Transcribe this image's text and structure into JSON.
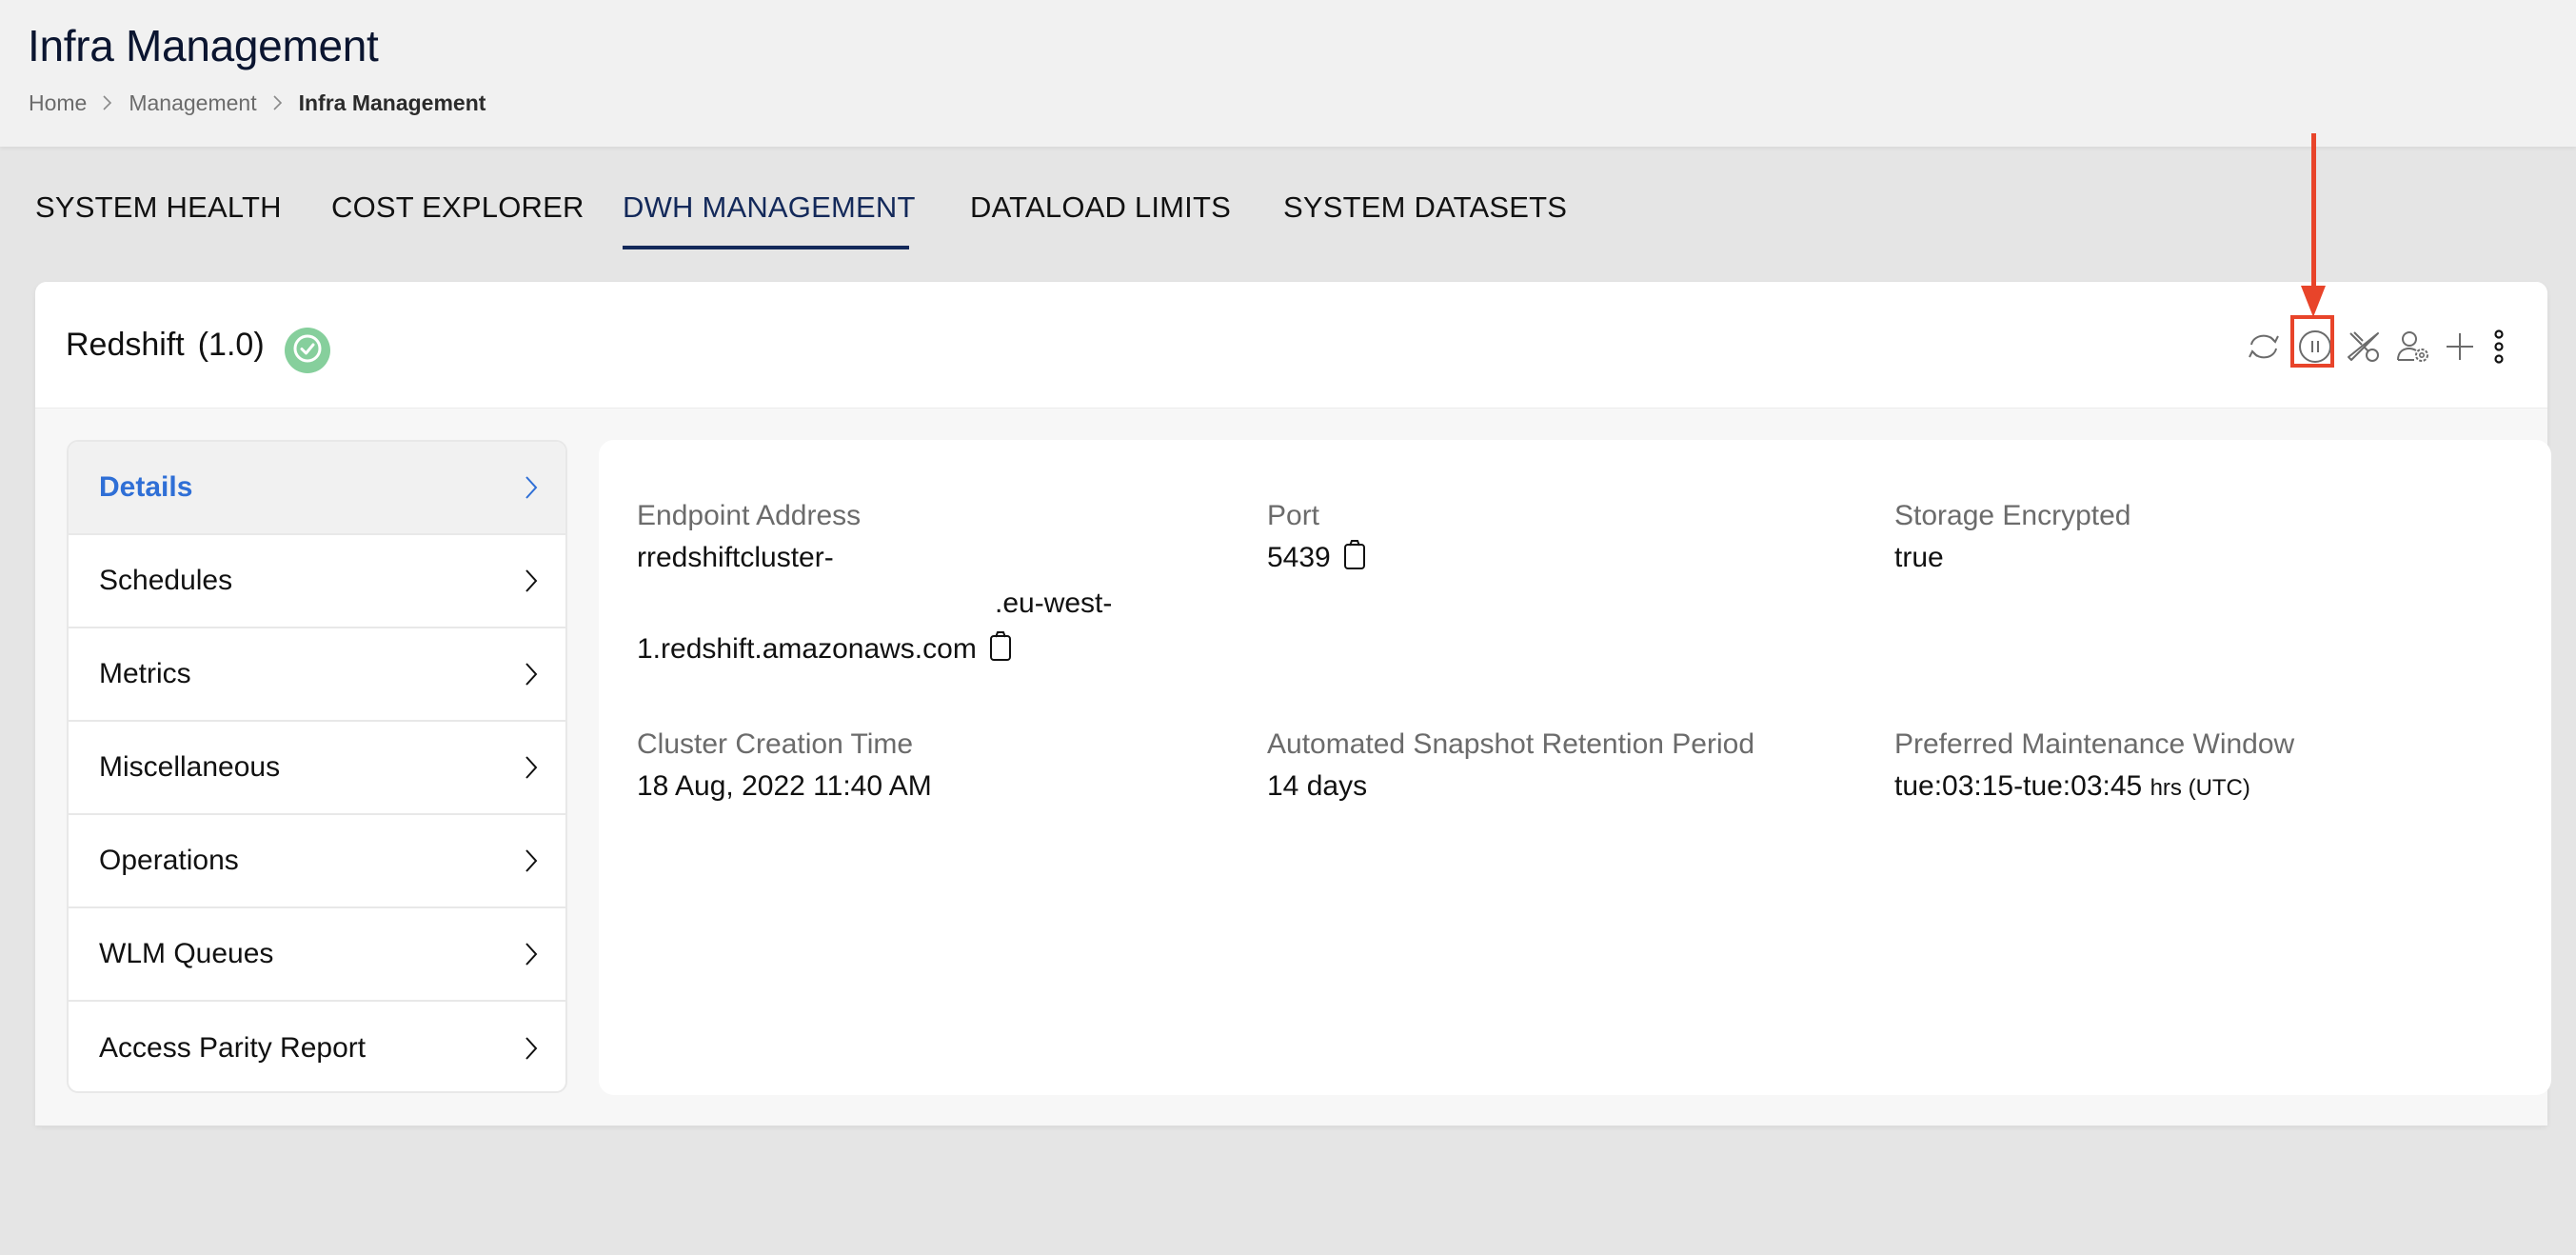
{
  "header": {
    "title": "Infra Management",
    "breadcrumb": [
      {
        "label": "Home"
      },
      {
        "label": "Management"
      },
      {
        "label": "Infra Management"
      }
    ]
  },
  "tabs": [
    {
      "label": "SYSTEM HEALTH",
      "active": false
    },
    {
      "label": "COST EXPLORER",
      "active": false
    },
    {
      "label": "DWH MANAGEMENT",
      "active": true
    },
    {
      "label": "DATALOAD LIMITS",
      "active": false
    },
    {
      "label": "SYSTEM DATASETS",
      "active": false
    }
  ],
  "card": {
    "title": "Redshift",
    "version": "(1.0)",
    "status": "healthy",
    "status_color": "#86cf9c",
    "toolbar": [
      {
        "icon": "refresh-icon",
        "label": "Refresh"
      },
      {
        "icon": "pause-icon",
        "label": "Pause",
        "highlighted": true
      },
      {
        "icon": "tools-icon",
        "label": "Maintenance"
      },
      {
        "icon": "user-settings-icon",
        "label": "User settings"
      },
      {
        "icon": "plus-icon",
        "label": "Add"
      },
      {
        "icon": "more-vertical-icon",
        "label": "More"
      }
    ]
  },
  "sidebar": {
    "items": [
      {
        "label": "Details",
        "active": true
      },
      {
        "label": "Schedules",
        "active": false
      },
      {
        "label": "Metrics",
        "active": false
      },
      {
        "label": "Miscellaneous",
        "active": false
      },
      {
        "label": "Operations",
        "active": false
      },
      {
        "label": "WLM Queues",
        "active": false
      },
      {
        "label": "Access Parity Report",
        "active": false
      }
    ]
  },
  "details": {
    "endpoint": {
      "label": "Endpoint Address",
      "line1": "rredshiftcluster-",
      "line2": ".eu-west-",
      "line3": "1.redshift.amazonaws.com"
    },
    "port": {
      "label": "Port",
      "value": "5439"
    },
    "storage_encrypted": {
      "label": "Storage Encrypted",
      "value": "true"
    },
    "cluster_creation_time": {
      "label": "Cluster Creation Time",
      "value": "18 Aug, 2022 11:40 AM"
    },
    "snapshot_retention": {
      "label": "Automated Snapshot Retention Period",
      "value": "14 days"
    },
    "maintenance_window": {
      "label": "Preferred Maintenance Window",
      "value": "tue:03:15-tue:03:45",
      "unit": "hrs (UTC)"
    }
  },
  "colors": {
    "accent": "#13295a",
    "link_active": "#2f6fd6",
    "annotation": "#e8442a"
  }
}
